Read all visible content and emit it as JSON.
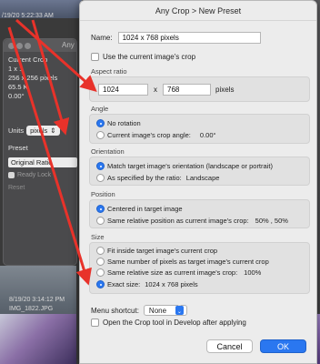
{
  "background": {
    "date_top": "/19/20 5:22:33 AM",
    "date_bottom": "8/19/20 3:14:12 PM",
    "filename": "IMG_1822.JPG"
  },
  "side_panel": {
    "title": "Any",
    "lines": [
      "Current Crop",
      "1 x 1",
      "256 x 256 pixels",
      "65.5 K",
      "0.00°"
    ],
    "units_label": "Units",
    "units_value": "pixels",
    "preset_label": "Preset",
    "preset_value": "Original Ratio",
    "check_label": "Ready Lock",
    "reset_label": "Reset"
  },
  "dialog": {
    "title": "Any Crop > New Preset",
    "name_label": "Name:",
    "name_value": "1024 x 768 pixels",
    "use_current_label": "Use the current image's crop",
    "aspect": {
      "label": "Aspect ratio",
      "width": "1024",
      "sep": "x",
      "height": "768",
      "units": "pixels"
    },
    "angle": {
      "label": "Angle",
      "options": [
        "No rotation",
        "Current image's crop angle:"
      ],
      "angle_value": "0.00°",
      "selected": 0
    },
    "orientation": {
      "label": "Orientation",
      "options": [
        "Match target image's orientation (landscape or portrait)",
        "As specified by the ratio:"
      ],
      "ratio_value": "Landscape",
      "selected": 0
    },
    "position": {
      "label": "Position",
      "options": [
        "Centered in target image",
        "Same relative position as current image's crop:"
      ],
      "relative_value": "50% , 50%",
      "selected": 0
    },
    "size": {
      "label": "Size",
      "options": [
        "Fit inside target image's current crop",
        "Same number of pixels as target image's current crop",
        "Same relative size as current image's crop:",
        "Exact size:"
      ],
      "relative_value": "100%",
      "exact_value": "1024 x 768 pixels",
      "selected": 3
    },
    "menu_shortcut_label": "Menu shortcut:",
    "menu_shortcut_value": "None",
    "open_crop_label": "Open the Crop tool in Develop after applying",
    "cancel_label": "Cancel",
    "ok_label": "OK"
  },
  "colors": {
    "accent": "#2a77f0",
    "annotation_arrow": "#e8322a"
  }
}
